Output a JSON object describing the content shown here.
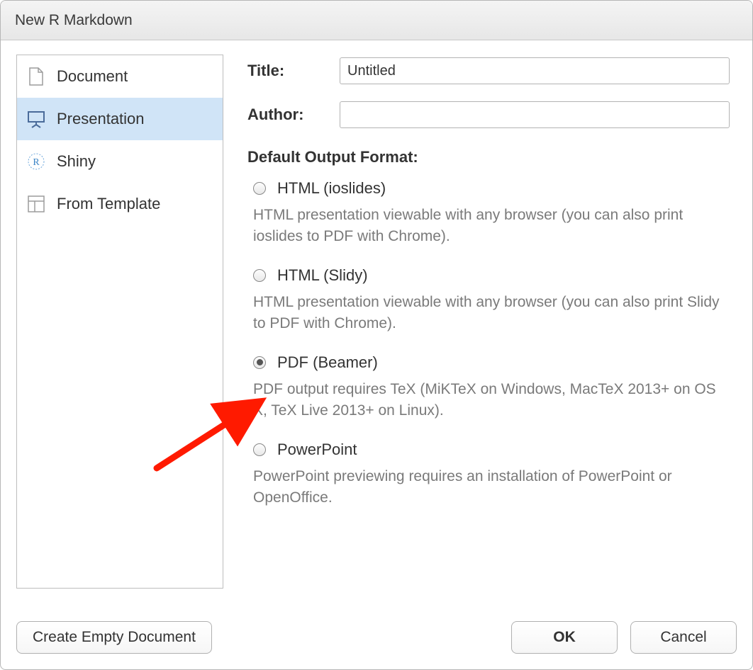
{
  "title": "New R Markdown",
  "sidebar": {
    "items": [
      {
        "label": "Document"
      },
      {
        "label": "Presentation"
      },
      {
        "label": "Shiny"
      },
      {
        "label": "From Template"
      }
    ],
    "selected_index": 1
  },
  "form": {
    "title_label": "Title:",
    "title_value": "Untitled",
    "author_label": "Author:",
    "author_value": ""
  },
  "output_section_label": "Default Output Format:",
  "options": [
    {
      "label": "HTML (ioslides)",
      "description": "HTML presentation viewable with any browser (you can also print ioslides to PDF with Chrome).",
      "selected": false
    },
    {
      "label": "HTML (Slidy)",
      "description": "HTML presentation viewable with any browser (you can also print Slidy to PDF with Chrome).",
      "selected": false
    },
    {
      "label": "PDF (Beamer)",
      "description": "PDF output requires TeX (MiKTeX on Windows, MacTeX 2013+ on OS X, TeX Live 2013+ on Linux).",
      "selected": true
    },
    {
      "label": "PowerPoint",
      "description": "PowerPoint previewing requires an installation of PowerPoint or OpenOffice.",
      "selected": false
    }
  ],
  "buttons": {
    "create_empty": "Create Empty Document",
    "ok": "OK",
    "cancel": "Cancel"
  }
}
